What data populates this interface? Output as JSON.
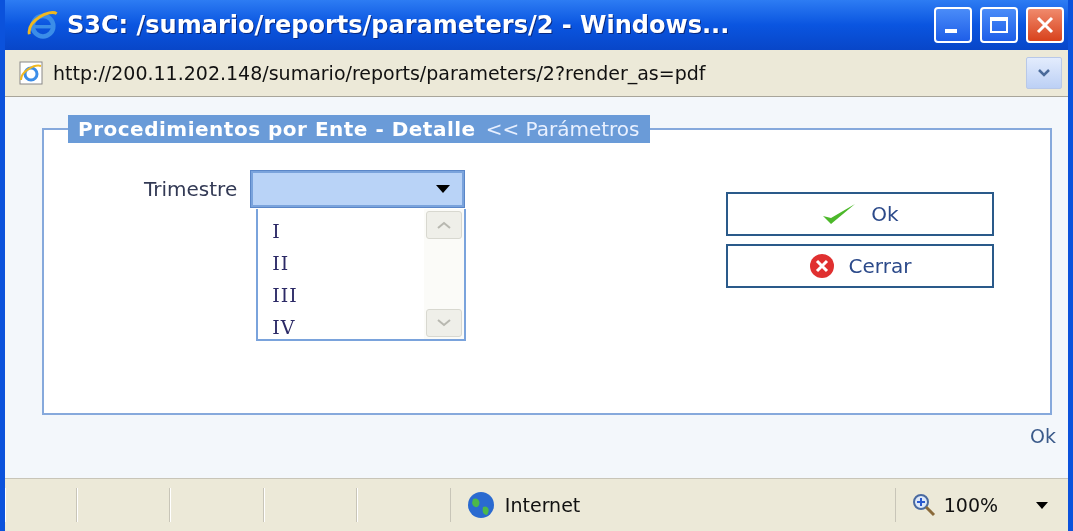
{
  "window": {
    "title": "S3C: /sumario/reports/parameters/2 - Windows..."
  },
  "address_bar": {
    "url": "http://200.11.202.148/sumario/reports/parameters/2?render_as=pdf"
  },
  "form": {
    "legend": {
      "title": "Procedimientos por Ente - Detalle",
      "link": "<< Parámetros"
    },
    "fields": [
      {
        "label": "Trimestre",
        "expanded": true,
        "options": [
          {
            "label": "I",
            "selected": false
          },
          {
            "label": "II",
            "selected": false
          },
          {
            "label": "III",
            "selected": false
          },
          {
            "label": "IV",
            "selected": false
          }
        ]
      }
    ],
    "buttons": [
      {
        "label": "Ok",
        "kind": "ok"
      },
      {
        "label": "Cerrar",
        "kind": "close"
      }
    ]
  },
  "footer_link": "Ok",
  "status_bar": {
    "zone": "Internet",
    "zoom": "100%"
  }
}
